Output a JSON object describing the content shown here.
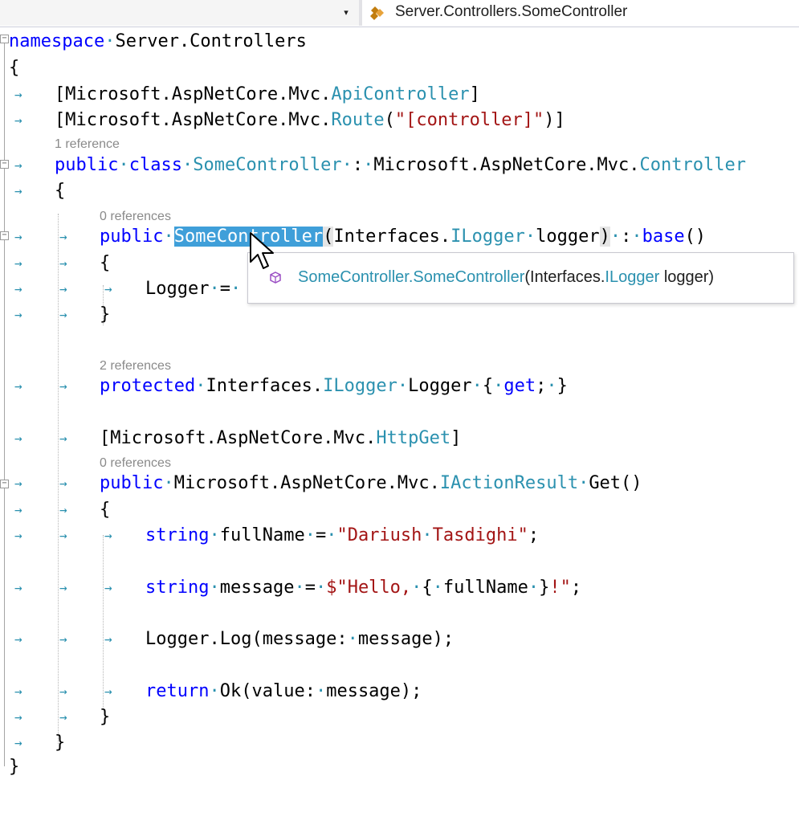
{
  "nav_bar": {
    "member_dropdown_arrow": "▾",
    "type_icon": "class-icon",
    "type_path": "Server.Controllers.SomeController"
  },
  "code": {
    "namespace_kw": "namespace",
    "namespace_name": "Server.Controllers",
    "brace_open": "{",
    "brace_close": "}",
    "attr1_prefix": "[Microsoft.AspNetCore.Mvc.",
    "attr1_type": "ApiController",
    "attr1_suffix": "]",
    "attr2_prefix": "[Microsoft.AspNetCore.Mvc.",
    "attr2_type": "Route",
    "attr2_paren": "(",
    "attr2_string": "\"[controller]\"",
    "attr2_suffix": ")]",
    "lens_class": "1 reference",
    "class_public": "public",
    "class_kw": "class",
    "class_name": "SomeController",
    "class_colon": ":",
    "class_base_prefix": "Microsoft.AspNetCore.Mvc.",
    "class_base_type": "Controller",
    "lens_ctor": "0 references",
    "ctor_public": "public",
    "ctor_name": "SomeController",
    "ctor_paren_open": "(",
    "ctor_param_ns": "Interfaces.",
    "ctor_param_type": "ILogger",
    "ctor_param_name": "logger",
    "ctor_paren_close": ")",
    "ctor_colon": ":",
    "ctor_base": "base",
    "ctor_base_parens": "()",
    "ctor_body": "Logger",
    "ctor_assign": "=",
    "lens_logger": "2 references",
    "prop_protected": "protected",
    "prop_ns": "Interfaces.",
    "prop_type": "ILogger",
    "prop_name": "Logger",
    "prop_brace_open": "{",
    "prop_get": "get",
    "prop_semicolon": ";",
    "prop_brace_close": "}",
    "attr3_prefix": "[Microsoft.AspNetCore.Mvc.",
    "attr3_type": "HttpGet",
    "attr3_suffix": "]",
    "lens_get": "0 references",
    "get_public": "public",
    "get_ret_ns": "Microsoft.AspNetCore.Mvc.",
    "get_ret_type": "IActionResult",
    "get_name": "Get()",
    "s1_type": "string",
    "s1_name": "fullName",
    "s1_eq": "=",
    "s1_value": "\"Dariush",
    "s1_value2": "Tasdighi\"",
    "s1_end": ";",
    "s2_type": "string",
    "s2_name": "message",
    "s2_eq": "=",
    "s2_value1": "$\"Hello,",
    "s2_brace_open": "{",
    "s2_var": "fullName",
    "s2_brace_close": "}",
    "s2_value2": "!\"",
    "s2_end": ";",
    "s3_call": "Logger.Log(message:",
    "s3_arg": "message);",
    "s4_return": "return",
    "s4_call": "Ok(value:",
    "s4_arg": "message);"
  },
  "quick_info": {
    "icon": "method-cube-icon",
    "owner_type": "SomeController",
    "dot": ".",
    "member": "SomeController",
    "paren_open": "(",
    "param_ns": "Interfaces.",
    "param_type": "ILogger",
    "param_rest": " logger)"
  },
  "colors": {
    "keyword": "#0000ff",
    "type": "#2b91af",
    "string": "#a31515",
    "selection": "#3f9fd9"
  }
}
